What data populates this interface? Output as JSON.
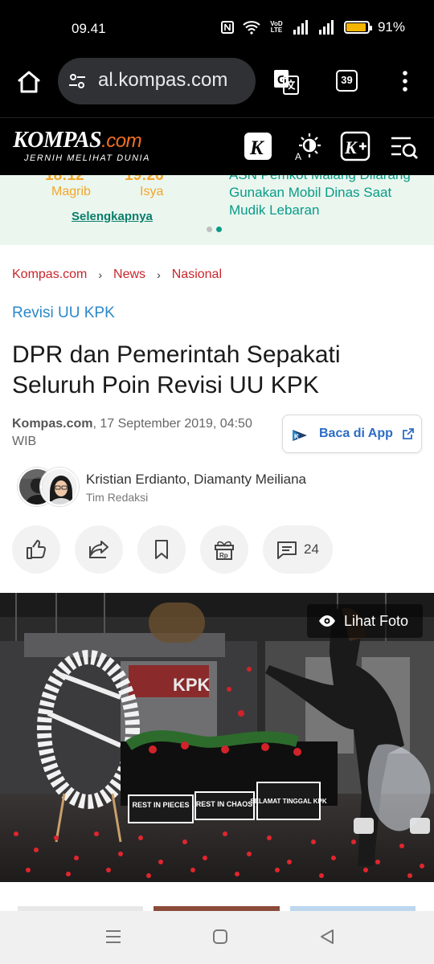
{
  "status_bar": {
    "time": "09.41",
    "battery_percent": "91%",
    "battery_level": 0.91,
    "volte_label": "VoD LTE",
    "icons": [
      "nfc-icon",
      "wifi-icon",
      "volte-icon",
      "signal-icon",
      "signal-icon",
      "battery-icon"
    ]
  },
  "browser": {
    "url": "al.kompas.com",
    "tab_count": "39",
    "icons": [
      "home-icon",
      "site-settings-icon",
      "translate-icon",
      "tabs-icon",
      "more-vert-icon"
    ]
  },
  "site_header": {
    "logo_main": "KOMPAS",
    "logo_suffix": ".com",
    "tagline": "JERNIH MELIHAT DUNIA",
    "icons": [
      "kompas-k-icon",
      "brightness-icon",
      "kompas-plus-icon",
      "search-menu-icon"
    ]
  },
  "ticker": {
    "prayers": [
      {
        "time": "18:12",
        "label": "Magrib"
      },
      {
        "time": "19:26",
        "label": "Isya"
      }
    ],
    "more_link": "Selengkapnya",
    "headline": "ASN Pemkot Malang Dilarang Gunakan Mobil Dinas Saat Mudik Lebaran",
    "slide_index": 1
  },
  "breadcrumb": [
    "Kompas.com",
    "News",
    "Nasional"
  ],
  "article": {
    "category": "Revisi UU KPK",
    "title": "DPR dan Pemerintah Sepakati Seluruh Poin Revisi UU KPK",
    "source": "Kompas.com",
    "date": ", 17 September 2019, 04:50 WIB",
    "app_button": "Baca di App",
    "authors": "Kristian Erdianto,  Diamanty Meiliana",
    "author_role": "Tim Redaksi",
    "comment_count": "24",
    "photo_button": "Lihat Foto",
    "photo_signs": [
      "REST IN PIECES",
      "REST IN CHAOS",
      "SELAMAT TINGGAL KPK"
    ],
    "photo_wall_sign": "KPK"
  },
  "colors": {
    "brand_orange": "#f36f21",
    "link_red": "#c9252b",
    "category_blue": "#2b88c8",
    "ticker_teal": "#0a9b89",
    "prayer_orange": "#f4a62a"
  }
}
